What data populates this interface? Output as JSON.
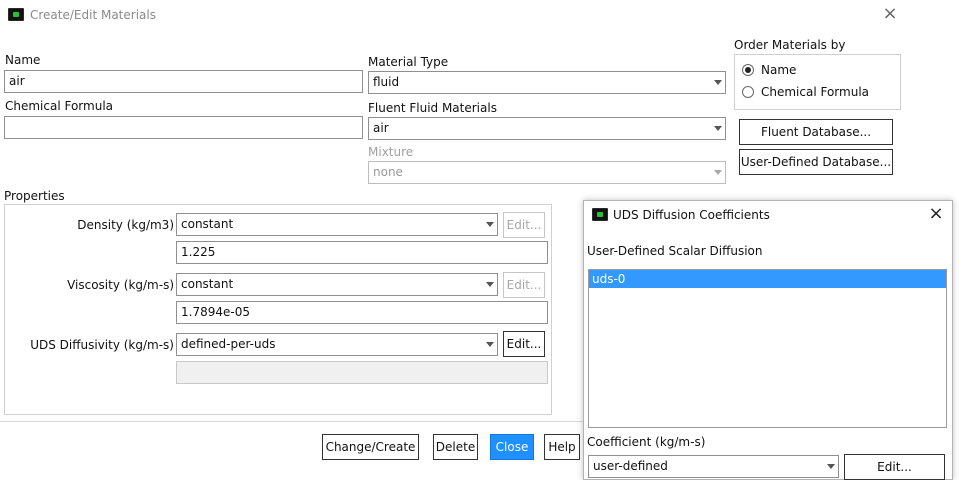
{
  "window": {
    "title": "Create/Edit Materials"
  },
  "name": {
    "label": "Name",
    "value": "air"
  },
  "chemical_formula": {
    "label": "Chemical Formula",
    "value": ""
  },
  "material_type": {
    "label": "Material Type",
    "value": "fluid"
  },
  "fluent_fluid_materials": {
    "label": "Fluent Fluid Materials",
    "value": "air"
  },
  "mixture": {
    "label": "Mixture",
    "value": "none"
  },
  "order_by": {
    "label": "Order Materials by",
    "options": [
      {
        "label": "Name",
        "checked": true
      },
      {
        "label": "Chemical Formula",
        "checked": false
      }
    ]
  },
  "database_buttons": {
    "fluent": "Fluent Database...",
    "user_defined": "User-Defined Database..."
  },
  "properties": {
    "label": "Properties",
    "density": {
      "label": "Density (kg/m3)",
      "method": "constant",
      "value": "1.225",
      "edit": "Edit..."
    },
    "viscosity": {
      "label": "Viscosity (kg/m-s)",
      "method": "constant",
      "value": "1.7894e-05",
      "edit": "Edit..."
    },
    "uds": {
      "label": "UDS Diffusivity (kg/m-s)",
      "method": "defined-per-uds",
      "value": "",
      "edit": "Edit..."
    }
  },
  "bottom_buttons": {
    "change_create": "Change/Create",
    "delete": "Delete",
    "close": "Close",
    "help": "Help"
  },
  "uds_dialog": {
    "title": "UDS Diffusion Coefficients",
    "list_label": "User-Defined Scalar Diffusion",
    "items": [
      "uds-0"
    ],
    "coefficient_label": "Coefficient (kg/m-s)",
    "coefficient_value": "user-defined",
    "edit": "Edit..."
  },
  "colors": {
    "accent": "#1e90ff",
    "selection": "#3399ff",
    "disabled_text": "#a0a0a0"
  }
}
